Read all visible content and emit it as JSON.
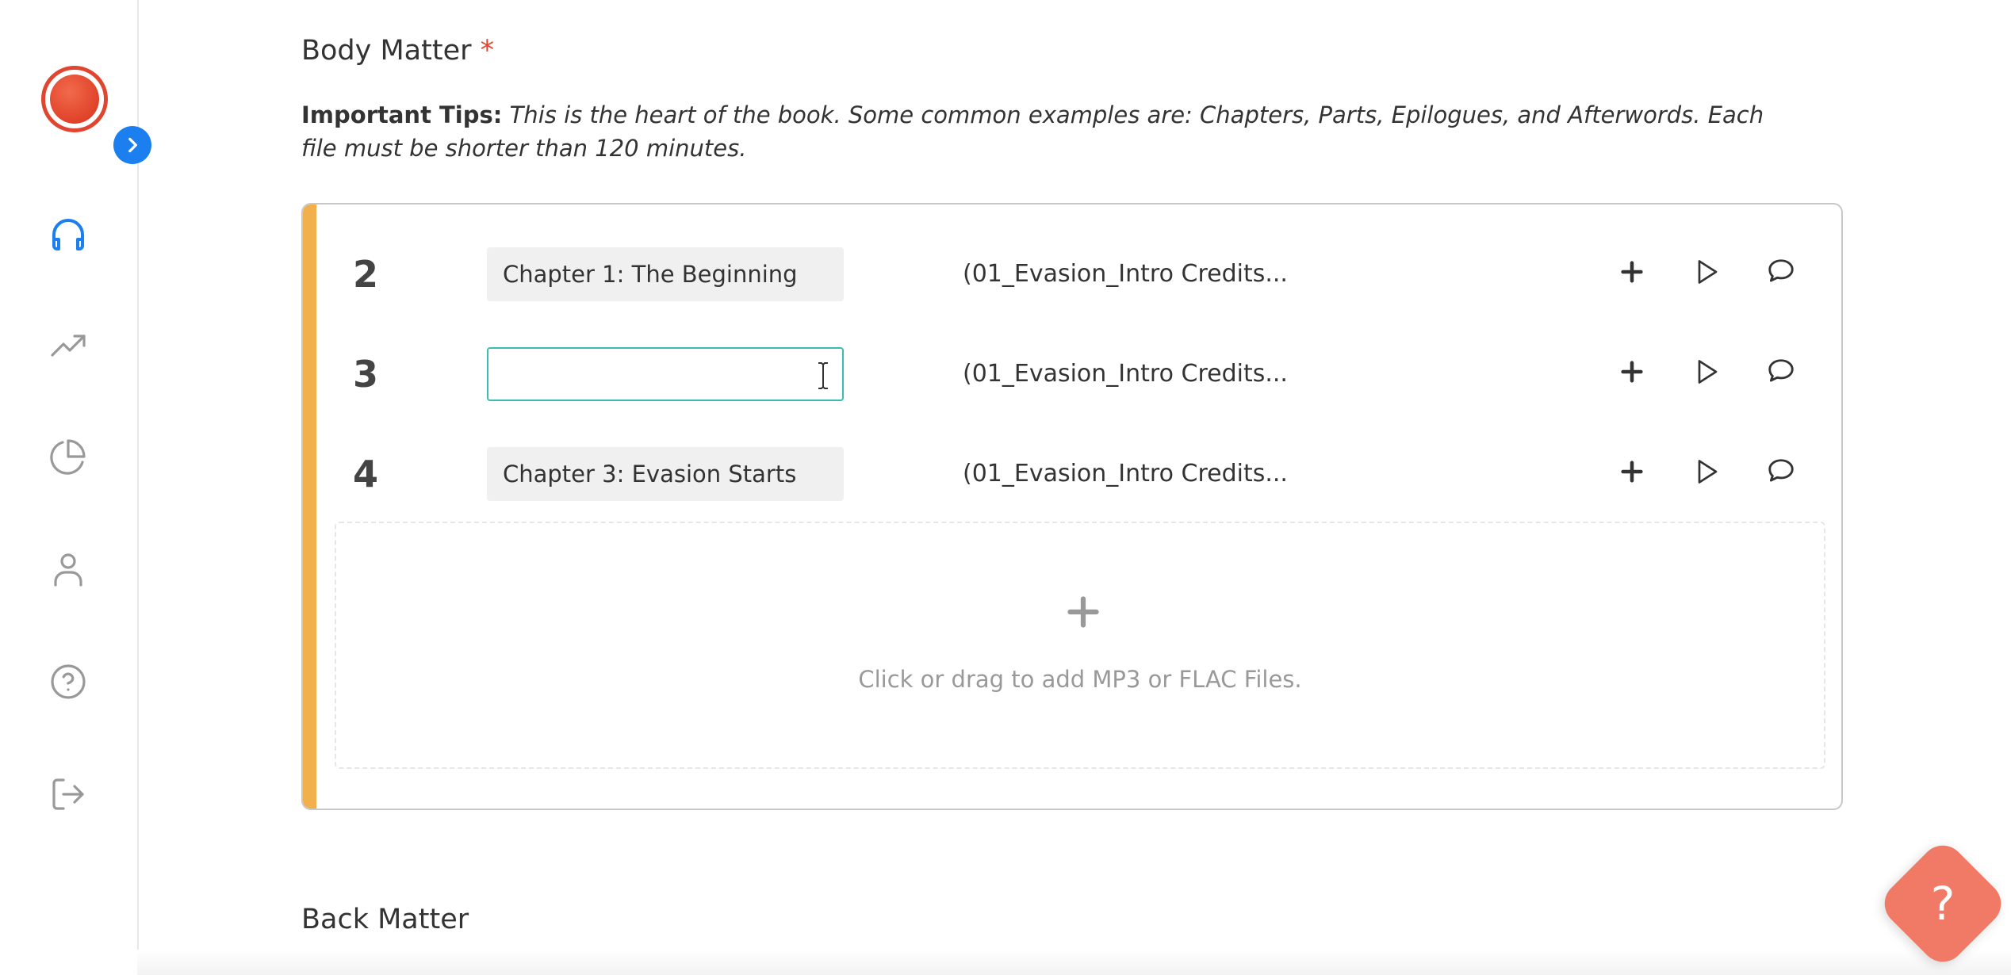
{
  "sections": {
    "body_title": "Body Matter",
    "required_mark": "*",
    "tips_label": "Important Tips:",
    "tips_text": "This is the heart of the book. Some common examples are: Chapters, Parts, Epilogues, and Afterwords. Each file must be shorter than 120 minutes.",
    "back_title": "Back Matter"
  },
  "rows": [
    {
      "num": "2",
      "title": "Chapter 1: The Beginning",
      "file": "(01_Evasion_Intro Credits..."
    },
    {
      "num": "3",
      "title": "",
      "file": "(01_Evasion_Intro Credits..."
    },
    {
      "num": "4",
      "title": "Chapter 3: Evasion Starts",
      "file": "(01_Evasion_Intro Credits..."
    }
  ],
  "dropzone": {
    "text": "Click or drag to add MP3 or FLAC Files."
  },
  "help": {
    "label": "?"
  },
  "colors": {
    "accent": "#f2b04d",
    "brand": "#e0462f",
    "focus": "#3cbcb0",
    "link": "#1c7ff0"
  }
}
